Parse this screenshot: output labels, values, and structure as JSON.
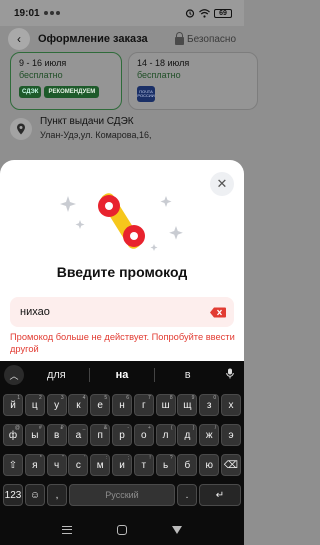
{
  "status_bar": {
    "time": "19:01",
    "battery": "69"
  },
  "header": {
    "back_glyph": "‹",
    "title": "Оформление заказа",
    "secure_label": "Безопасно"
  },
  "delivery_options": [
    {
      "dates": "9 - 16 июля",
      "price": "бесплатно",
      "logo": "СДЭК",
      "tag": "РЕКОМЕНДУЕМ"
    },
    {
      "dates": "14 - 18 июля",
      "price": "бесплатно",
      "logo": "ПОЧТА РОССИИ"
    }
  ],
  "pickup": {
    "title": "Пункт выдачи СДЭК",
    "address": "Улан-Удэ,ул. Комарова,16,"
  },
  "promo_sheet": {
    "close_glyph": "✕",
    "title": "Введите промокод",
    "input_value": "нихао",
    "error": "Промокод больше не действует. Попробуйте ввести другой",
    "colors": {
      "error": "#e23c33",
      "input_bg": "#fdeeed",
      "badge_red": "#e8232e",
      "badge_yellow": "#f6c71c"
    }
  },
  "keyboard": {
    "suggestions": [
      "для",
      "на",
      "в"
    ],
    "rows": [
      [
        {
          "k": "й",
          "h": "1"
        },
        {
          "k": "ц",
          "h": "2"
        },
        {
          "k": "у",
          "h": "3"
        },
        {
          "k": "к",
          "h": "4"
        },
        {
          "k": "е",
          "h": "5"
        },
        {
          "k": "н",
          "h": "6"
        },
        {
          "k": "г",
          "h": "7"
        },
        {
          "k": "ш",
          "h": "8"
        },
        {
          "k": "щ",
          "h": "9"
        },
        {
          "k": "з",
          "h": "0"
        },
        {
          "k": "х",
          "h": ""
        }
      ],
      [
        {
          "k": "ф",
          "h": "@"
        },
        {
          "k": "ы",
          "h": "#"
        },
        {
          "k": "в",
          "h": "₽"
        },
        {
          "k": "а",
          "h": "_"
        },
        {
          "k": "п",
          "h": "&"
        },
        {
          "k": "р",
          "h": "-"
        },
        {
          "k": "о",
          "h": "+"
        },
        {
          "k": "л",
          "h": "("
        },
        {
          "k": "д",
          "h": ")"
        },
        {
          "k": "ж",
          "h": "/"
        },
        {
          "k": "э",
          "h": ""
        }
      ],
      [
        {
          "k": "⇧",
          "h": ""
        },
        {
          "k": "я",
          "h": "*"
        },
        {
          "k": "ч",
          "h": "\""
        },
        {
          "k": "с",
          "h": "'"
        },
        {
          "k": "м",
          "h": ":"
        },
        {
          "k": "и",
          "h": ";"
        },
        {
          "k": "т",
          "h": "!"
        },
        {
          "k": "ь",
          "h": "?"
        },
        {
          "k": "б",
          "h": ""
        },
        {
          "k": "ю",
          "h": ""
        },
        {
          "k": "⌫",
          "h": ""
        }
      ]
    ],
    "bottom_row": {
      "symbols": "123",
      "emoji": "☺",
      "comma": ",",
      "space": "Русский",
      "period": ".",
      "enter": "↵"
    }
  }
}
